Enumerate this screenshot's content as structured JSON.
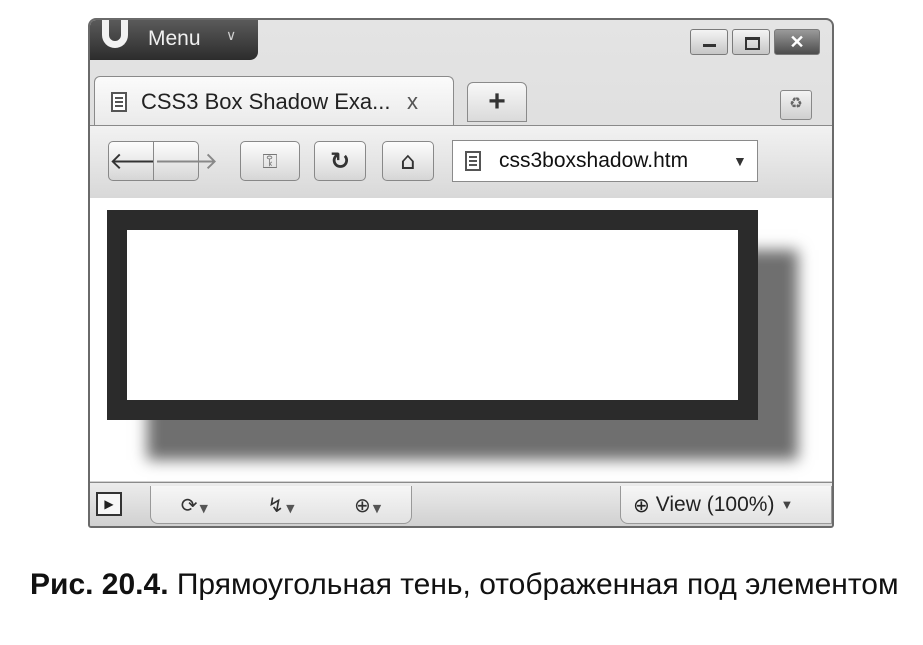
{
  "titlebar": {
    "menu_label": "Menu",
    "window_controls": [
      "minimize",
      "maximize",
      "close"
    ]
  },
  "tabs": [
    {
      "title": "CSS3 Box Shadow Exa...",
      "close_label": "x"
    }
  ],
  "new_tab_label": "+",
  "toolbar": {
    "buttons": [
      "back-icon",
      "forward-icon",
      "wand-icon",
      "reload-icon",
      "home-icon"
    ],
    "address": {
      "url": "css3boxshadow.htm"
    }
  },
  "page_content": {
    "box_border_color": "#2b2b2b",
    "shadow_color": "#6f6f6f"
  },
  "statusbar": {
    "zoom_label": "View (100%)"
  },
  "caption": {
    "number": "Рис. 20.4.",
    "text": " Прямоугольная тень, отображенная под элементом"
  }
}
